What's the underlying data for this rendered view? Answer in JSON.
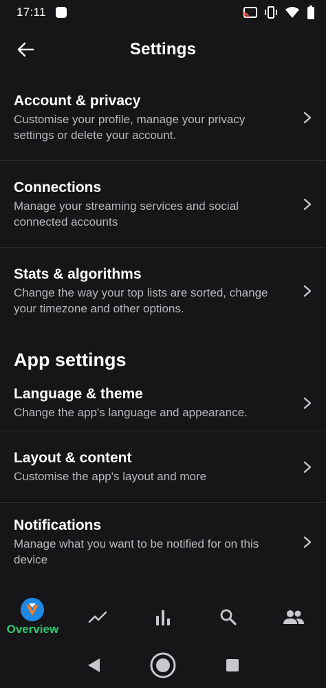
{
  "status_bar": {
    "time": "17:11"
  },
  "app_bar": {
    "title": "Settings"
  },
  "settings": [
    {
      "title": "Account & privacy",
      "subtitle_lines": [
        "Customise your profile, manage your privacy",
        "settings or delete your account."
      ]
    },
    {
      "title": "Connections",
      "subtitle_lines": [
        "Manage your streaming services and social",
        "connected accounts"
      ]
    },
    {
      "title": "Stats & algorithms",
      "subtitle_lines": [
        "Change the way your top lists are sorted, change",
        "your timezone and other options."
      ]
    }
  ],
  "app_settings": {
    "section_title": "App settings",
    "items": [
      {
        "title": "Language & theme",
        "subtitle_lines": [
          "Change the app's language and appearance."
        ]
      },
      {
        "title": "Layout & content",
        "subtitle_lines": [
          "Customise the app's layout and more"
        ]
      },
      {
        "title": "Notifications",
        "subtitle_lines": [
          "Manage what you want to be notified for on this",
          "device"
        ]
      }
    ]
  },
  "bottom_nav": {
    "active_label": "Overview",
    "active_color": "#2ecc71",
    "items": [
      "avatar",
      "trending-icon",
      "bar-chart-icon",
      "search-icon",
      "people-icon"
    ]
  },
  "colors": {
    "background": "#161618",
    "divider": "#2b2b2e",
    "subtitle": "#b8b8bc"
  }
}
